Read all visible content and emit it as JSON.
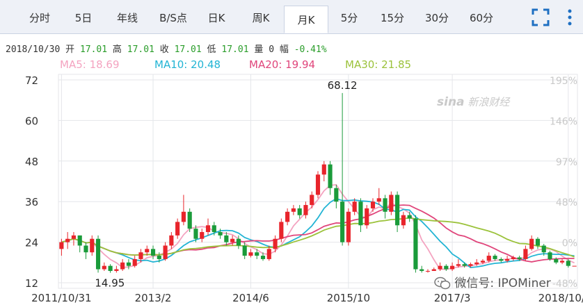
{
  "tabs": [
    {
      "label": "分时",
      "active": false
    },
    {
      "label": "5日",
      "active": false
    },
    {
      "label": "年线",
      "active": false
    },
    {
      "label": "B/S点",
      "active": false
    },
    {
      "label": "日K",
      "active": false
    },
    {
      "label": "周K",
      "active": false
    },
    {
      "label": "月K",
      "active": true
    },
    {
      "label": "5分",
      "active": false
    },
    {
      "label": "15分",
      "active": false
    },
    {
      "label": "30分",
      "active": false
    },
    {
      "label": "60分",
      "active": false
    }
  ],
  "icons": {
    "fullscreen": "fullscreen-icon",
    "more": "more-vertical-icon"
  },
  "quote": {
    "date": "2018/10/30",
    "open_label": "开",
    "open": "17.01",
    "high_label": "高",
    "high": "17.01",
    "close_label": "收",
    "close": "17.01",
    "low_label": "低",
    "low": "17.01",
    "volume_label": "量",
    "volume": "0",
    "change_label": "幅",
    "change": "-0.41%"
  },
  "ma_legend": [
    {
      "text": "MA5: 18.69",
      "color": "#f4a3c0"
    },
    {
      "text": "MA10: 20.48",
      "color": "#22b4d4"
    },
    {
      "text": "MA20: 19.94",
      "color": "#e0457b"
    },
    {
      "text": "MA30: 21.85",
      "color": "#9bc23a"
    }
  ],
  "watermarks": {
    "sina": "新浪财经",
    "sina_logo": "sina",
    "wechat": "微信号: IPOMiner"
  },
  "colors": {
    "up": "#e8242b",
    "down": "#1a9b3a",
    "tab_bg": "#eef1f7",
    "grid": "#e4e6ea"
  },
  "chart_data": {
    "type": "candlestick",
    "ylim": [
      12,
      72
    ],
    "y_ticks": [
      72,
      60,
      48,
      36,
      24,
      12
    ],
    "y_ticks_right": [
      "195%",
      "146%",
      "97%",
      "48%",
      "0%",
      "-48%"
    ],
    "x_labels": [
      {
        "index": 0,
        "label": "2011/10/31"
      },
      {
        "index": 15,
        "label": "2013/2"
      },
      {
        "index": 31,
        "label": "2014/6"
      },
      {
        "index": 47,
        "label": "2015/10"
      },
      {
        "index": 64,
        "label": "2017/3"
      },
      {
        "index": 83,
        "label": "2018/10/30"
      }
    ],
    "annotations": [
      {
        "index": 46,
        "value": 68.12,
        "label": "68.12"
      },
      {
        "index": 7,
        "value": 14.95,
        "label": "14.95"
      }
    ],
    "candles": [
      [
        22,
        24,
        25,
        20
      ],
      [
        24,
        25,
        27,
        22
      ],
      [
        25,
        26,
        27,
        23
      ],
      [
        26,
        23,
        26,
        21
      ],
      [
        23,
        21,
        24,
        19
      ],
      [
        21,
        25,
        26,
        20
      ],
      [
        25,
        16,
        26,
        15
      ],
      [
        16,
        17,
        18,
        15.5
      ],
      [
        17,
        15.5,
        17.5,
        14.95
      ],
      [
        15.5,
        16,
        17,
        15
      ],
      [
        16,
        18,
        19,
        15.5
      ],
      [
        18,
        17,
        19,
        16
      ],
      [
        17,
        19,
        20,
        16.5
      ],
      [
        19,
        21,
        22,
        18
      ],
      [
        21,
        22,
        23,
        20
      ],
      [
        22,
        20,
        23,
        19
      ],
      [
        20,
        19,
        21,
        18
      ],
      [
        19,
        23,
        24,
        18.5
      ],
      [
        23,
        26,
        27,
        22
      ],
      [
        26,
        30,
        31,
        25
      ],
      [
        30,
        33,
        38,
        29
      ],
      [
        33,
        28,
        34,
        27
      ],
      [
        28,
        25,
        29,
        24
      ],
      [
        25,
        27,
        28,
        24
      ],
      [
        27,
        29,
        31,
        26
      ],
      [
        29,
        27,
        30,
        26
      ],
      [
        27,
        26,
        28,
        25
      ],
      [
        26,
        24,
        27,
        23
      ],
      [
        24,
        25,
        26,
        23
      ],
      [
        25,
        23,
        26,
        22
      ],
      [
        23,
        20,
        24,
        19
      ],
      [
        20,
        21,
        22,
        19.5
      ],
      [
        21,
        20,
        22,
        19
      ],
      [
        20,
        19,
        21,
        18.5
      ],
      [
        19,
        22,
        23,
        18.5
      ],
      [
        22,
        25,
        26,
        21
      ],
      [
        25,
        30,
        31,
        24
      ],
      [
        30,
        33,
        34,
        29
      ],
      [
        33,
        34,
        35,
        32
      ],
      [
        34,
        32,
        35,
        31
      ],
      [
        32,
        35,
        36,
        31
      ],
      [
        35,
        38,
        39,
        34
      ],
      [
        38,
        44,
        45,
        37
      ],
      [
        44,
        47,
        48,
        42
      ],
      [
        47,
        40,
        48,
        38
      ],
      [
        40,
        36,
        41,
        34
      ],
      [
        36,
        24,
        68.12,
        23
      ],
      [
        24,
        33,
        34,
        23
      ],
      [
        33,
        36,
        37,
        32
      ],
      [
        36,
        29,
        37,
        27
      ],
      [
        29,
        34,
        35,
        28
      ],
      [
        34,
        36,
        37,
        33
      ],
      [
        36,
        37,
        40,
        35
      ],
      [
        37,
        33,
        38,
        31
      ],
      [
        33,
        38,
        39,
        32
      ],
      [
        38,
        29,
        39,
        27
      ],
      [
        29,
        32,
        33,
        28
      ],
      [
        32,
        31,
        33,
        30
      ],
      [
        31,
        16,
        32,
        15
      ],
      [
        16,
        15.5,
        17,
        15
      ],
      [
        15.5,
        15.5,
        16,
        15
      ],
      [
        15.5,
        16,
        16.5,
        15.5
      ],
      [
        16,
        17,
        18,
        15.5
      ],
      [
        17,
        16,
        17.5,
        15.5
      ],
      [
        16,
        17,
        18,
        15.5
      ],
      [
        17,
        17.5,
        19,
        16.5
      ],
      [
        17.5,
        17,
        18,
        16.5
      ],
      [
        17,
        17.5,
        18,
        16.5
      ],
      [
        17.5,
        18,
        19,
        17
      ],
      [
        18,
        18.5,
        19,
        17.5
      ],
      [
        18.5,
        20,
        21,
        18
      ],
      [
        20,
        19,
        20.5,
        18.5
      ],
      [
        19,
        18.5,
        19.5,
        18
      ],
      [
        18.5,
        19,
        20,
        18
      ],
      [
        19,
        19.5,
        20,
        18.5
      ],
      [
        19.5,
        19,
        20,
        18.5
      ],
      [
        19,
        22,
        23,
        18.5
      ],
      [
        22,
        25,
        26,
        21.5
      ],
      [
        25,
        23,
        25.5,
        22
      ],
      [
        23,
        21,
        23.5,
        20
      ],
      [
        21,
        19,
        21.5,
        18.5
      ],
      [
        19,
        18,
        19.5,
        17.5
      ],
      [
        18,
        18.5,
        19,
        17.5
      ],
      [
        18.5,
        17,
        19,
        16.5
      ],
      [
        17,
        17.01,
        17.01,
        17.01
      ]
    ]
  }
}
